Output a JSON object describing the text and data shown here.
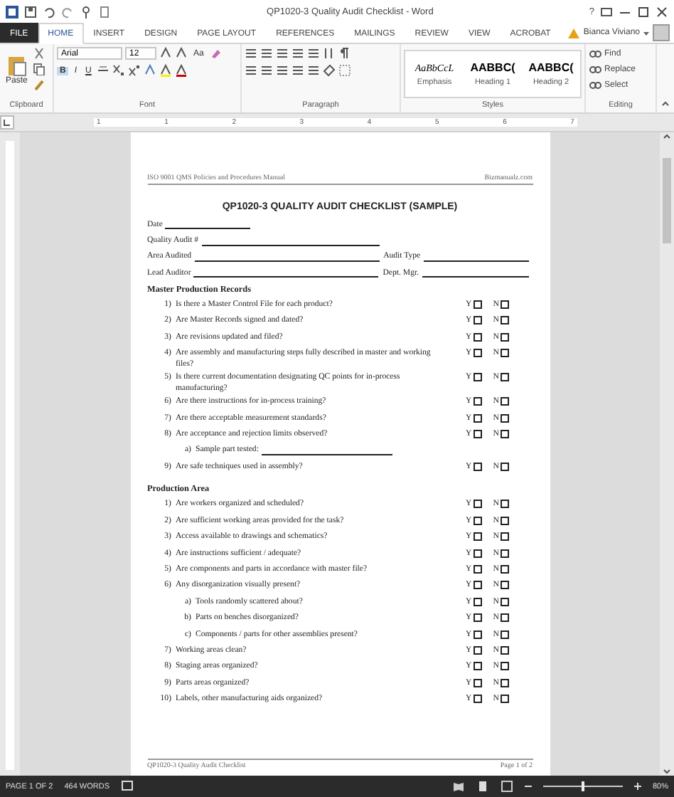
{
  "title_bar": {
    "title": "QP1020-3 Quality Audit Checklist - Word",
    "help": "?"
  },
  "tabs": [
    {
      "label": "FILE",
      "kind": "file",
      "selected": false
    },
    {
      "label": "HOME",
      "kind": "tab",
      "selected": true
    },
    {
      "label": "INSERT",
      "kind": "tab",
      "selected": false
    },
    {
      "label": "DESIGN",
      "kind": "tab",
      "selected": false
    },
    {
      "label": "PAGE LAYOUT",
      "kind": "tab",
      "selected": false
    },
    {
      "label": "REFERENCES",
      "kind": "tab",
      "selected": false
    },
    {
      "label": "MAILINGS",
      "kind": "tab",
      "selected": false
    },
    {
      "label": "REVIEW",
      "kind": "tab",
      "selected": false
    },
    {
      "label": "VIEW",
      "kind": "tab",
      "selected": false
    },
    {
      "label": "ACROBAT",
      "kind": "tab",
      "selected": false
    }
  ],
  "user": {
    "name": "Bianca Viviano"
  },
  "ribbon": {
    "clipboard": {
      "paste": "Paste",
      "label": "Clipboard"
    },
    "font": {
      "name": "Arial",
      "size": "12",
      "case": "Aa",
      "bold": "B",
      "italic": "I",
      "underline": "U",
      "label": "Font"
    },
    "paragraph": {
      "label": "Paragraph"
    },
    "styles": {
      "items": [
        {
          "preview": "AaBbCcL",
          "name": "Emphasis",
          "kind": "italic"
        },
        {
          "preview": "AABBC(",
          "name": "Heading 1",
          "kind": "heading"
        },
        {
          "preview": "AABBC(",
          "name": "Heading 2",
          "kind": "heading"
        }
      ],
      "label": "Styles"
    },
    "editing": {
      "items": [
        "Find",
        "Replace",
        "Select"
      ],
      "label": "Editing"
    }
  },
  "ruler": [
    "1",
    "1",
    "2",
    "3",
    "4",
    "5",
    "6",
    "7"
  ],
  "document": {
    "header_left": "ISO 9001 QMS Policies and Procedures Manual",
    "header_right": "Bizmanualz.com",
    "title": "QP1020-3 QUALITY AUDIT CHECKLIST (SAMPLE)",
    "field_rows": [
      [
        {
          "label": "Date",
          "kind": "short"
        }
      ],
      [
        {
          "label": "Quality Audit #",
          "kind": "long"
        }
      ],
      [
        {
          "label": "Area Audited",
          "kind": "fill"
        },
        {
          "label": "Audit Type",
          "kind": "fill"
        }
      ],
      [
        {
          "label": "Lead Auditor",
          "kind": "fill"
        },
        {
          "label": "Dept. Mgr.",
          "kind": "fill"
        }
      ]
    ],
    "sections": [
      {
        "heading": "Master Production Records",
        "items": [
          {
            "kind": "question",
            "number": "1)",
            "text": "Is there a Master Control File for each product?",
            "options": [
              {
                "label": "Y",
                "checked": false
              },
              {
                "label": "N",
                "checked": false
              }
            ]
          },
          {
            "kind": "question",
            "number": "2)",
            "text": "Are Master Records signed and dated?",
            "options": [
              {
                "label": "Y",
                "checked": false
              },
              {
                "label": "N",
                "checked": false
              }
            ]
          },
          {
            "kind": "question",
            "number": "3)",
            "text": "Are revisions updated and filed?",
            "options": [
              {
                "label": "Y",
                "checked": false
              },
              {
                "label": "N",
                "checked": false
              }
            ]
          },
          {
            "kind": "question",
            "number": "4)",
            "text": "Are assembly and manufacturing steps fully described in master and working files?",
            "options": [
              {
                "label": "Y",
                "checked": false
              },
              {
                "label": "N",
                "checked": false
              }
            ]
          },
          {
            "kind": "question",
            "number": "5)",
            "text": "Is there current documentation designating QC points for in-process manufacturing?",
            "options": [
              {
                "label": "Y",
                "checked": false
              },
              {
                "label": "N",
                "checked": false
              }
            ]
          },
          {
            "kind": "question",
            "number": "6)",
            "text": "Are there instructions for in-process training?",
            "options": [
              {
                "label": "Y",
                "checked": false
              },
              {
                "label": "N",
                "checked": false
              }
            ]
          },
          {
            "kind": "question",
            "number": "7)",
            "text": "Are there acceptable measurement standards?",
            "options": [
              {
                "label": "Y",
                "checked": false
              },
              {
                "label": "N",
                "checked": false
              }
            ]
          },
          {
            "kind": "question",
            "number": "8)",
            "text": "Are acceptance and rejection limits observed?",
            "options": [
              {
                "label": "Y",
                "checked": false
              },
              {
                "label": "N",
                "checked": false
              }
            ],
            "children": [
              {
                "kind": "fill",
                "number": "a)",
                "text": "Sample part tested:"
              }
            ]
          },
          {
            "kind": "question",
            "number": "9)",
            "text": "Are safe techniques used in assembly?",
            "options": [
              {
                "label": "Y",
                "checked": false
              },
              {
                "label": "N",
                "checked": false
              }
            ]
          }
        ]
      },
      {
        "heading": "Production Area",
        "items": [
          {
            "kind": "question",
            "number": "1)",
            "text": "Are workers organized and scheduled?",
            "options": [
              {
                "label": "Y",
                "checked": false
              },
              {
                "label": "N",
                "checked": false
              }
            ]
          },
          {
            "kind": "question",
            "number": "2)",
            "text": "Are sufficient working areas provided for the task?",
            "options": [
              {
                "label": "Y",
                "checked": false
              },
              {
                "label": "N",
                "checked": false
              }
            ]
          },
          {
            "kind": "question",
            "number": "3)",
            "text": "Access available to drawings and schematics?",
            "options": [
              {
                "label": "Y",
                "checked": false
              },
              {
                "label": "N",
                "checked": false
              }
            ]
          },
          {
            "kind": "question",
            "number": "4)",
            "text": "Are instructions sufficient / adequate?",
            "options": [
              {
                "label": "Y",
                "checked": false
              },
              {
                "label": "N",
                "checked": false
              }
            ]
          },
          {
            "kind": "question",
            "number": "5)",
            "text": "Are components and parts in accordance with master file?",
            "options": [
              {
                "label": "Y",
                "checked": false
              },
              {
                "label": "N",
                "checked": false
              }
            ]
          },
          {
            "kind": "question",
            "number": "6)",
            "text": "Any disorganization visually present?",
            "options": [
              {
                "label": "Y",
                "checked": false
              },
              {
                "label": "N",
                "checked": false
              }
            ],
            "children": [
              {
                "kind": "question",
                "number": "a)",
                "text": "Tools randomly scattered about?",
                "options": [
                  {
                    "label": "Y",
                    "checked": false
                  },
                  {
                    "label": "N",
                    "checked": false
                  }
                ]
              },
              {
                "kind": "question",
                "number": "b)",
                "text": "Parts on benches disorganized?",
                "options": [
                  {
                    "label": "Y",
                    "checked": false
                  },
                  {
                    "label": "N",
                    "checked": false
                  }
                ]
              },
              {
                "kind": "question",
                "number": "c)",
                "text": "Components / parts for other assemblies present?",
                "options": [
                  {
                    "label": "Y",
                    "checked": false
                  },
                  {
                    "label": "N",
                    "checked": false
                  }
                ]
              }
            ]
          },
          {
            "kind": "question",
            "number": "7)",
            "text": "Working areas clean?",
            "options": [
              {
                "label": "Y",
                "checked": false
              },
              {
                "label": "N",
                "checked": false
              }
            ]
          },
          {
            "kind": "question",
            "number": "8)",
            "text": "Staging areas organized?",
            "options": [
              {
                "label": "Y",
                "checked": false
              },
              {
                "label": "N",
                "checked": false
              }
            ]
          },
          {
            "kind": "question",
            "number": "9)",
            "text": "Parts areas organized?",
            "options": [
              {
                "label": "Y",
                "checked": false
              },
              {
                "label": "N",
                "checked": false
              }
            ]
          },
          {
            "kind": "question",
            "number": "10)",
            "text": "Labels, other manufacturing aids organized?",
            "options": [
              {
                "label": "Y",
                "checked": false
              },
              {
                "label": "N",
                "checked": false
              }
            ]
          }
        ]
      }
    ],
    "footer_left": "QP1020-3 Quality Audit Checklist",
    "footer_right": "Page 1 of 2"
  },
  "status_bar": {
    "page": "PAGE 1 OF 2",
    "words": "464 WORDS",
    "zoom": "80%",
    "zoom_level": {
      "level": 0.5
    }
  }
}
